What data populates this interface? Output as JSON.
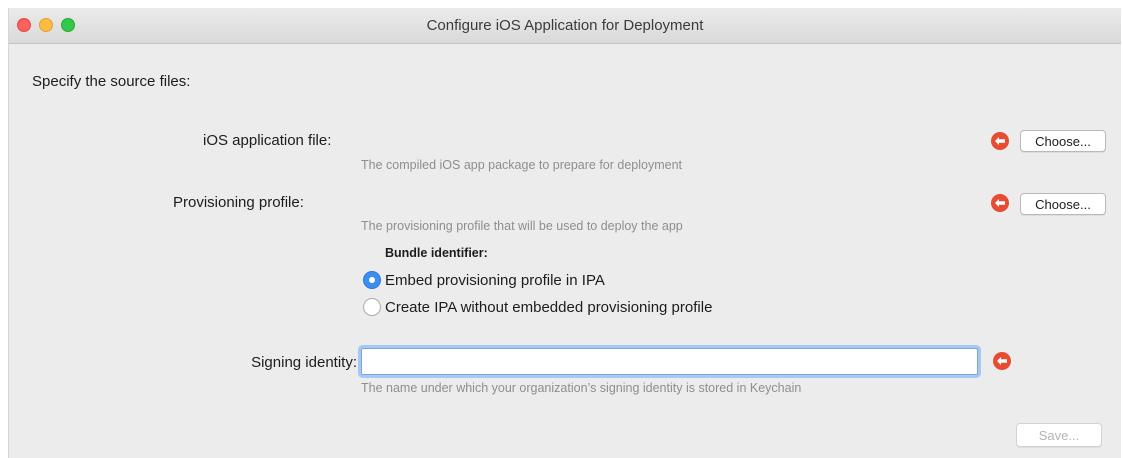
{
  "window": {
    "title": "Configure iOS Application for Deployment",
    "traffic_lights": {
      "close": "#fc605c",
      "minimize": "#fdbc40",
      "maximize": "#34c84a"
    }
  },
  "section_title": "Specify the source files:",
  "ios_app": {
    "label": "iOS application file:",
    "hint": "The compiled iOS app package to prepare for deployment",
    "button": "Choose...",
    "status_icon": "error-arrow-icon"
  },
  "provisioning": {
    "label": "Provisioning profile:",
    "hint": "The provisioning profile that will be used to deploy the app",
    "button": "Choose...",
    "status_icon": "error-arrow-icon"
  },
  "bundle": {
    "heading": "Bundle identifier:",
    "options": [
      {
        "label": "Embed provisioning profile in IPA",
        "selected": true
      },
      {
        "label": "Create IPA without embedded provisioning profile",
        "selected": false
      }
    ]
  },
  "signing": {
    "label": "Signing identity:",
    "value": "",
    "hint": "The name under which your organization’s signing identity is stored in Keychain",
    "status_icon": "error-arrow-icon"
  },
  "footer": {
    "save_label": "Save...",
    "save_enabled": false
  },
  "colors": {
    "accent": "#3d8ef0",
    "error": "#e84b32",
    "window_bg": "#ececec"
  }
}
